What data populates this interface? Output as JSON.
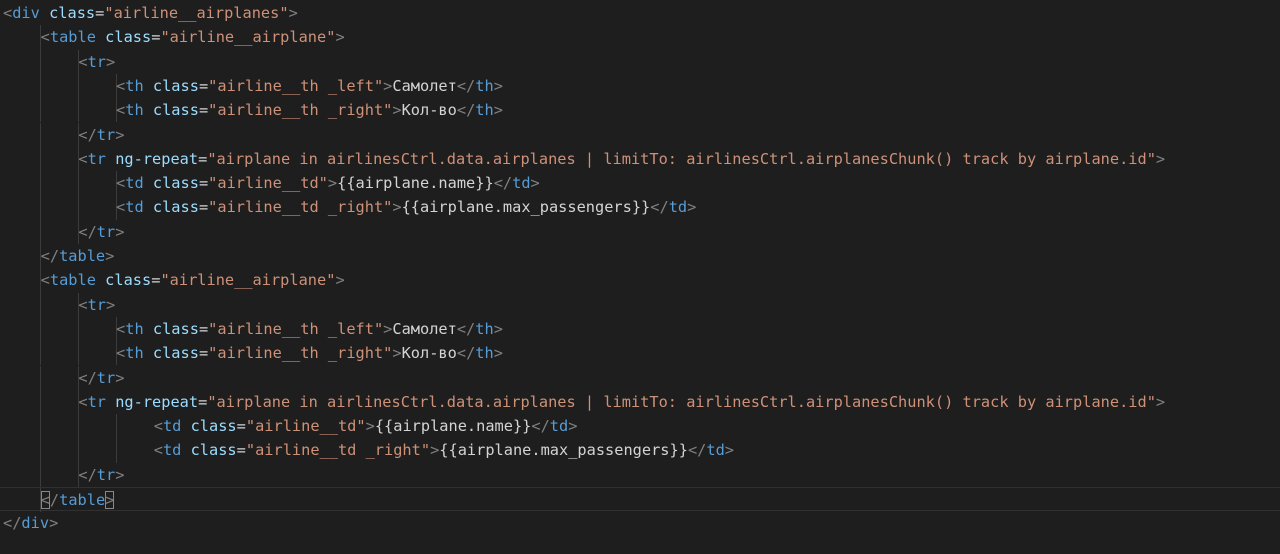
{
  "editor": {
    "theme": {
      "background": "#1e1e1e",
      "bracket": "#808080",
      "tag": "#569cd6",
      "attribute": "#9cdcfe",
      "string": "#ce9178",
      "text": "#d4d4d4",
      "indent_guide": "#3c3c3c"
    },
    "current_line": 21,
    "lines": [
      {
        "indent": 0,
        "tokens": [
          [
            "p",
            "<"
          ],
          [
            "t",
            "div"
          ],
          [
            "x",
            " "
          ],
          [
            "a",
            "class"
          ],
          [
            "eq",
            "="
          ],
          [
            "s",
            "\"airline__airplanes\""
          ],
          [
            "p",
            ">"
          ]
        ]
      },
      {
        "indent": 1,
        "tokens": [
          [
            "p",
            "<"
          ],
          [
            "t",
            "table"
          ],
          [
            "x",
            " "
          ],
          [
            "a",
            "class"
          ],
          [
            "eq",
            "="
          ],
          [
            "s",
            "\"airline__airplane\""
          ],
          [
            "p",
            ">"
          ]
        ]
      },
      {
        "indent": 2,
        "tokens": [
          [
            "p",
            "<"
          ],
          [
            "t",
            "tr"
          ],
          [
            "p",
            ">"
          ]
        ]
      },
      {
        "indent": 3,
        "tokens": [
          [
            "p",
            "<"
          ],
          [
            "t",
            "th"
          ],
          [
            "x",
            " "
          ],
          [
            "a",
            "class"
          ],
          [
            "eq",
            "="
          ],
          [
            "s",
            "\"airline__th _left\""
          ],
          [
            "p",
            ">"
          ],
          [
            "x",
            "Самолет"
          ],
          [
            "p",
            "</"
          ],
          [
            "t",
            "th"
          ],
          [
            "p",
            ">"
          ]
        ]
      },
      {
        "indent": 3,
        "tokens": [
          [
            "p",
            "<"
          ],
          [
            "t",
            "th"
          ],
          [
            "x",
            " "
          ],
          [
            "a",
            "class"
          ],
          [
            "eq",
            "="
          ],
          [
            "s",
            "\"airline__th _right\""
          ],
          [
            "p",
            ">"
          ],
          [
            "x",
            "Кол-во"
          ],
          [
            "p",
            "</"
          ],
          [
            "t",
            "th"
          ],
          [
            "p",
            ">"
          ]
        ]
      },
      {
        "indent": 2,
        "tokens": [
          [
            "p",
            "</"
          ],
          [
            "t",
            "tr"
          ],
          [
            "p",
            ">"
          ]
        ]
      },
      {
        "indent": 2,
        "tokens": [
          [
            "p",
            "<"
          ],
          [
            "t",
            "tr"
          ],
          [
            "x",
            " "
          ],
          [
            "a",
            "ng-repeat"
          ],
          [
            "eq",
            "="
          ],
          [
            "s",
            "\"airplane in airlinesCtrl.data.airplanes | limitTo: airlinesCtrl.airplanesChunk() track by airplane.id\""
          ],
          [
            "p",
            ">"
          ]
        ]
      },
      {
        "indent": 3,
        "tokens": [
          [
            "p",
            "<"
          ],
          [
            "t",
            "td"
          ],
          [
            "x",
            " "
          ],
          [
            "a",
            "class"
          ],
          [
            "eq",
            "="
          ],
          [
            "s",
            "\"airline__td\""
          ],
          [
            "p",
            ">"
          ],
          [
            "x",
            "{{airplane.name}}"
          ],
          [
            "p",
            "</"
          ],
          [
            "t",
            "td"
          ],
          [
            "p",
            ">"
          ]
        ]
      },
      {
        "indent": 3,
        "tokens": [
          [
            "p",
            "<"
          ],
          [
            "t",
            "td"
          ],
          [
            "x",
            " "
          ],
          [
            "a",
            "class"
          ],
          [
            "eq",
            "="
          ],
          [
            "s",
            "\"airline__td _right\""
          ],
          [
            "p",
            ">"
          ],
          [
            "x",
            "{{airplane.max_passengers}}"
          ],
          [
            "p",
            "</"
          ],
          [
            "t",
            "td"
          ],
          [
            "p",
            ">"
          ]
        ]
      },
      {
        "indent": 2,
        "tokens": [
          [
            "p",
            "</"
          ],
          [
            "t",
            "tr"
          ],
          [
            "p",
            ">"
          ]
        ]
      },
      {
        "indent": 1,
        "tokens": [
          [
            "p",
            "</"
          ],
          [
            "t",
            "table"
          ],
          [
            "p",
            ">"
          ]
        ]
      },
      {
        "indent": 1,
        "tokens": [
          [
            "p",
            "<"
          ],
          [
            "t",
            "table"
          ],
          [
            "x",
            " "
          ],
          [
            "a",
            "class"
          ],
          [
            "eq",
            "="
          ],
          [
            "s",
            "\"airline__airplane\""
          ],
          [
            "p",
            ">"
          ]
        ]
      },
      {
        "indent": 2,
        "tokens": [
          [
            "p",
            "<"
          ],
          [
            "t",
            "tr"
          ],
          [
            "p",
            ">"
          ]
        ]
      },
      {
        "indent": 3,
        "tokens": [
          [
            "p",
            "<"
          ],
          [
            "t",
            "th"
          ],
          [
            "x",
            " "
          ],
          [
            "a",
            "class"
          ],
          [
            "eq",
            "="
          ],
          [
            "s",
            "\"airline__th _left\""
          ],
          [
            "p",
            ">"
          ],
          [
            "x",
            "Самолет"
          ],
          [
            "p",
            "</"
          ],
          [
            "t",
            "th"
          ],
          [
            "p",
            ">"
          ]
        ]
      },
      {
        "indent": 3,
        "tokens": [
          [
            "p",
            "<"
          ],
          [
            "t",
            "th"
          ],
          [
            "x",
            " "
          ],
          [
            "a",
            "class"
          ],
          [
            "eq",
            "="
          ],
          [
            "s",
            "\"airline__th _right\""
          ],
          [
            "p",
            ">"
          ],
          [
            "x",
            "Кол-во"
          ],
          [
            "p",
            "</"
          ],
          [
            "t",
            "th"
          ],
          [
            "p",
            ">"
          ]
        ]
      },
      {
        "indent": 2,
        "tokens": [
          [
            "p",
            "</"
          ],
          [
            "t",
            "tr"
          ],
          [
            "p",
            ">"
          ]
        ]
      },
      {
        "indent": 2,
        "tokens": [
          [
            "p",
            "<"
          ],
          [
            "t",
            "tr"
          ],
          [
            "x",
            " "
          ],
          [
            "a",
            "ng-repeat"
          ],
          [
            "eq",
            "="
          ],
          [
            "s",
            "\"airplane in airlinesCtrl.data.airplanes | limitTo: airlinesCtrl.airplanesChunk() track by airplane.id\""
          ],
          [
            "p",
            ">"
          ]
        ]
      },
      {
        "indent": 4,
        "tokens": [
          [
            "p",
            "<"
          ],
          [
            "t",
            "td"
          ],
          [
            "x",
            " "
          ],
          [
            "a",
            "class"
          ],
          [
            "eq",
            "="
          ],
          [
            "s",
            "\"airline__td\""
          ],
          [
            "p",
            ">"
          ],
          [
            "x",
            "{{airplane.name}}"
          ],
          [
            "p",
            "</"
          ],
          [
            "t",
            "td"
          ],
          [
            "p",
            ">"
          ]
        ]
      },
      {
        "indent": 4,
        "tokens": [
          [
            "p",
            "<"
          ],
          [
            "t",
            "td"
          ],
          [
            "x",
            " "
          ],
          [
            "a",
            "class"
          ],
          [
            "eq",
            "="
          ],
          [
            "s",
            "\"airline__td _right\""
          ],
          [
            "p",
            ">"
          ],
          [
            "x",
            "{{airplane.max_passengers}}"
          ],
          [
            "p",
            "</"
          ],
          [
            "t",
            "td"
          ],
          [
            "p",
            ">"
          ]
        ]
      },
      {
        "indent": 2,
        "tokens": [
          [
            "p",
            "</"
          ],
          [
            "t",
            "tr"
          ],
          [
            "p",
            ">"
          ]
        ]
      },
      {
        "indent": 1,
        "tokens": [
          [
            "pm",
            "<"
          ],
          [
            "p",
            "/"
          ],
          [
            "t",
            "table"
          ],
          [
            "pm",
            ">"
          ]
        ]
      },
      {
        "indent": 0,
        "tokens": [
          [
            "p",
            "</"
          ],
          [
            "t",
            "div"
          ],
          [
            "p",
            ">"
          ]
        ]
      }
    ]
  }
}
